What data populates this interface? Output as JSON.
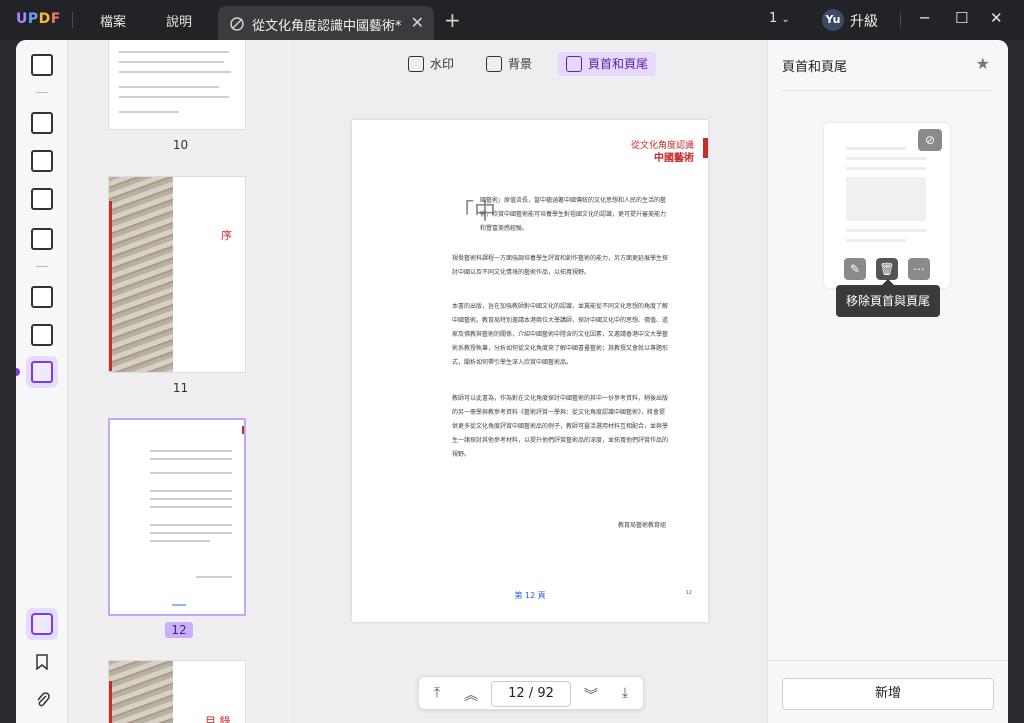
{
  "app": {
    "logo": {
      "u": "U",
      "p": "P",
      "d": "D",
      "f": "F"
    },
    "menu": [
      "檔案",
      "說明"
    ],
    "tab_title": "從文化角度認識中國藝術*",
    "page_indicator": "1",
    "avatar": "Yu",
    "upgrade": "升級"
  },
  "toolbar": {
    "watermark": "水印",
    "background": "背景",
    "header_footer": "頁首和頁尾"
  },
  "thumbnails": {
    "labels": [
      "10",
      "11",
      "12"
    ],
    "page11_title": "序",
    "page13_title": "目 錄",
    "selected_index": 2
  },
  "document": {
    "header_line1": "從文化角度認識",
    "header_line2": "中國藝術",
    "drop_char": "中",
    "paragraphs": [
      "國藝術」原值流長，當中蘊涵著中國傳統的文化思想和人民的生活的藝術，欣賞中國藝術能可培養學生對祖國文化的認識，更可提升審美能力和豐富美感經驗。",
      "視覺藝術科課程一方面強調培養學生評賞和創作藝術的能力，另方面更延展學生探討中國以及不同文化情境的藝術作品，以拓寬視野。",
      "本書的出版，旨在加強教師對中國文化的認識，並冀能從不同文化思想的角度了解中國藝術。教育局特別邀請本港兩位大學講師，探討中國文化中的思想、價值、道家及佛教與藝術的關係，介紹中國藝術中隱含的文化因素，又邀請香港中文大學藝術系教授執筆，分析如何從文化角度來了解中國書畫藝術；其教授又會就以專題形式，闡析如何帶引學生深入欣賞中國藝術品。",
      "教師可以此書為，作為對在文化角度探討中國藝術的其中一份參考資料，稍後出版的另一冊學與教參考資料《藝術評賞一學與：從文化角度認識中國藝術》，將會提供更多從文化角度評賞中國藝術品的例子，教師可靈活選用材料互相配合，並與學生一諸探討其他參考材料，以提升他們評賞藝術品的深度，並拓寬他們評賞作品的視野。"
    ],
    "signature": "教育局藝術教育組",
    "page_number": "第 12 頁",
    "page_number_small": "12"
  },
  "navigation": {
    "current_page": "12",
    "separator": "/",
    "total_pages": "92"
  },
  "right_panel": {
    "title": "頁首和頁尾",
    "tooltip": "移除頁首與頁尾",
    "add_button": "新增"
  },
  "colors": {
    "accent": "#7c3aed",
    "accent_light": "#e5dafb",
    "doc_red": "#c52b2b",
    "link_blue": "#2563eb"
  },
  "icons": [
    "document-icon",
    "highlight-icon",
    "edit-icon",
    "reader-icon",
    "form-icon",
    "organize-icon",
    "crop-icon",
    "watermark-tool-icon",
    "layers-icon",
    "bookmark-icon",
    "attachment-icon",
    "star-icon",
    "hide-icon",
    "pencil-icon",
    "trash-icon",
    "more-icon"
  ]
}
